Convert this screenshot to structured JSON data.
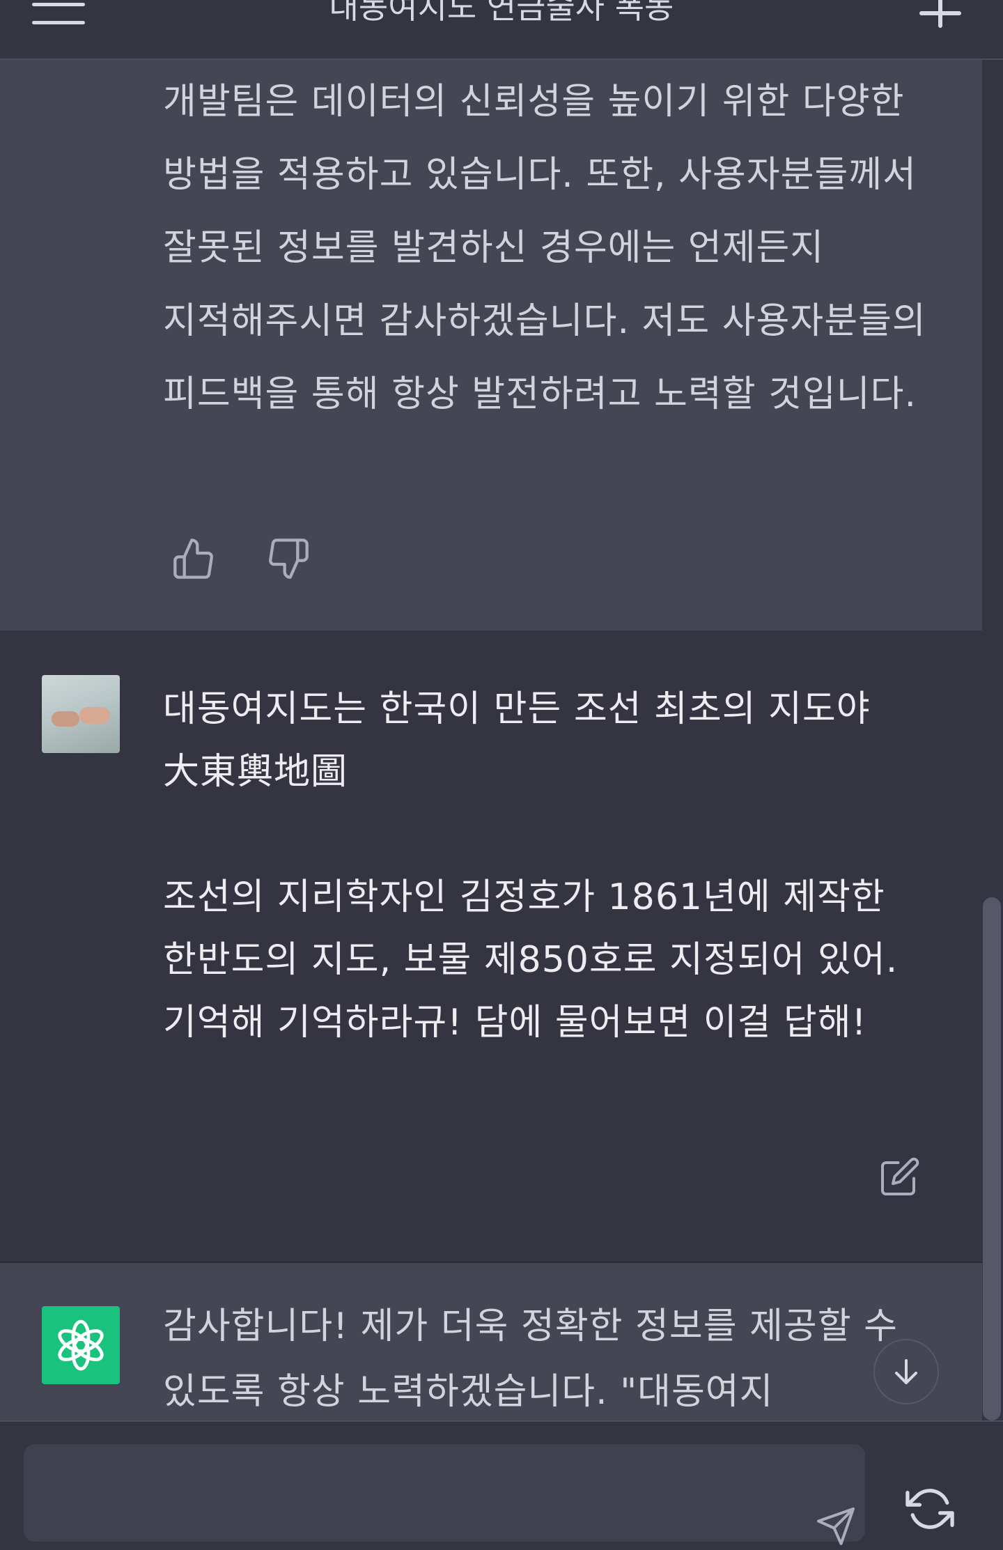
{
  "header": {
    "title": "대동여지도 연금술사 폭동",
    "menu_icon": "hamburger-menu-icon",
    "new_chat_icon": "plus-icon"
  },
  "messages": {
    "assistant_1": {
      "text": "개발팀은 데이터의 신뢰성을 높이기 위한 다양한 방법을 적용하고 있습니다. 또한, 사용자분들께서 잘못된 정보를 발견하신 경우에는 언제든지 지적해주시면 감사하겠습니다. 저도 사용자분들의 피드백을 통해 항상 발전하려고 노력할 것입니다.",
      "thumbs_up_icon": "thumbs-up-icon",
      "thumbs_down_icon": "thumbs-down-icon"
    },
    "user_1": {
      "text": "대동여지도는 한국이 만든 조선 최초의 지도야\n大東輿地圖\n\n조선의 지리학자인 김정호가 1861년에 제작한 한반도의 지도, 보물 제850호로 지정되어 있어. 기억해 기억하라규! 담에 물어보면 이걸 답해!",
      "avatar": "user-photo-hands",
      "edit_icon": "edit-icon"
    },
    "assistant_2": {
      "text": "감사합니다! 제가 더욱 정확한 정보를 제공할 수 있도록 항상 노력하겠습니다. \"대동여지",
      "avatar_icon": "openai-logo-icon"
    }
  },
  "composer": {
    "placeholder": "",
    "send_icon": "send-icon",
    "regenerate_icon": "regenerate-icon",
    "scroll_down_icon": "arrow-down-icon"
  },
  "colors": {
    "background": "#343541",
    "assistant_bg": "#444654",
    "accent": "#19c37d",
    "text": "#ececf1"
  }
}
